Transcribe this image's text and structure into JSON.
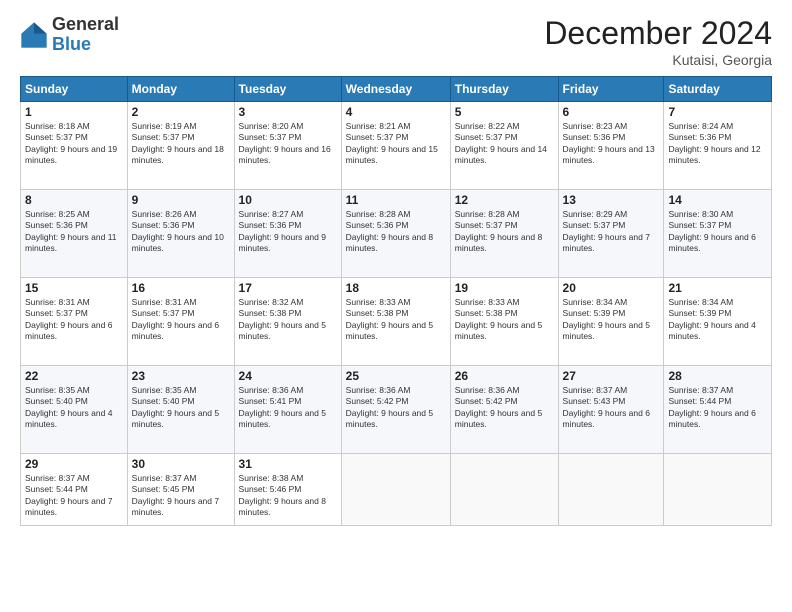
{
  "logo": {
    "general": "General",
    "blue": "Blue"
  },
  "title": "December 2024",
  "location": "Kutaisi, Georgia",
  "days_header": [
    "Sunday",
    "Monday",
    "Tuesday",
    "Wednesday",
    "Thursday",
    "Friday",
    "Saturday"
  ],
  "weeks": [
    [
      {
        "day": "1",
        "sunrise": "8:18 AM",
        "sunset": "5:37 PM",
        "daylight_hours": "9",
        "daylight_minutes": "19"
      },
      {
        "day": "2",
        "sunrise": "8:19 AM",
        "sunset": "5:37 PM",
        "daylight_hours": "9",
        "daylight_minutes": "18"
      },
      {
        "day": "3",
        "sunrise": "8:20 AM",
        "sunset": "5:37 PM",
        "daylight_hours": "9",
        "daylight_minutes": "16"
      },
      {
        "day": "4",
        "sunrise": "8:21 AM",
        "sunset": "5:37 PM",
        "daylight_hours": "9",
        "daylight_minutes": "15"
      },
      {
        "day": "5",
        "sunrise": "8:22 AM",
        "sunset": "5:37 PM",
        "daylight_hours": "9",
        "daylight_minutes": "14"
      },
      {
        "day": "6",
        "sunrise": "8:23 AM",
        "sunset": "5:36 PM",
        "daylight_hours": "9",
        "daylight_minutes": "13"
      },
      {
        "day": "7",
        "sunrise": "8:24 AM",
        "sunset": "5:36 PM",
        "daylight_hours": "9",
        "daylight_minutes": "12"
      }
    ],
    [
      {
        "day": "8",
        "sunrise": "8:25 AM",
        "sunset": "5:36 PM",
        "daylight_hours": "9",
        "daylight_minutes": "11"
      },
      {
        "day": "9",
        "sunrise": "8:26 AM",
        "sunset": "5:36 PM",
        "daylight_hours": "9",
        "daylight_minutes": "10"
      },
      {
        "day": "10",
        "sunrise": "8:27 AM",
        "sunset": "5:36 PM",
        "daylight_hours": "9",
        "daylight_minutes": "9"
      },
      {
        "day": "11",
        "sunrise": "8:28 AM",
        "sunset": "5:36 PM",
        "daylight_hours": "9",
        "daylight_minutes": "8"
      },
      {
        "day": "12",
        "sunrise": "8:28 AM",
        "sunset": "5:37 PM",
        "daylight_hours": "9",
        "daylight_minutes": "8"
      },
      {
        "day": "13",
        "sunrise": "8:29 AM",
        "sunset": "5:37 PM",
        "daylight_hours": "9",
        "daylight_minutes": "7"
      },
      {
        "day": "14",
        "sunrise": "8:30 AM",
        "sunset": "5:37 PM",
        "daylight_hours": "9",
        "daylight_minutes": "6"
      }
    ],
    [
      {
        "day": "15",
        "sunrise": "8:31 AM",
        "sunset": "5:37 PM",
        "daylight_hours": "9",
        "daylight_minutes": "6"
      },
      {
        "day": "16",
        "sunrise": "8:31 AM",
        "sunset": "5:37 PM",
        "daylight_hours": "9",
        "daylight_minutes": "6"
      },
      {
        "day": "17",
        "sunrise": "8:32 AM",
        "sunset": "5:38 PM",
        "daylight_hours": "9",
        "daylight_minutes": "5"
      },
      {
        "day": "18",
        "sunrise": "8:33 AM",
        "sunset": "5:38 PM",
        "daylight_hours": "9",
        "daylight_minutes": "5"
      },
      {
        "day": "19",
        "sunrise": "8:33 AM",
        "sunset": "5:38 PM",
        "daylight_hours": "9",
        "daylight_minutes": "5"
      },
      {
        "day": "20",
        "sunrise": "8:34 AM",
        "sunset": "5:39 PM",
        "daylight_hours": "9",
        "daylight_minutes": "5"
      },
      {
        "day": "21",
        "sunrise": "8:34 AM",
        "sunset": "5:39 PM",
        "daylight_hours": "9",
        "daylight_minutes": "4"
      }
    ],
    [
      {
        "day": "22",
        "sunrise": "8:35 AM",
        "sunset": "5:40 PM",
        "daylight_hours": "9",
        "daylight_minutes": "4"
      },
      {
        "day": "23",
        "sunrise": "8:35 AM",
        "sunset": "5:40 PM",
        "daylight_hours": "9",
        "daylight_minutes": "5"
      },
      {
        "day": "24",
        "sunrise": "8:36 AM",
        "sunset": "5:41 PM",
        "daylight_hours": "9",
        "daylight_minutes": "5"
      },
      {
        "day": "25",
        "sunrise": "8:36 AM",
        "sunset": "5:42 PM",
        "daylight_hours": "9",
        "daylight_minutes": "5"
      },
      {
        "day": "26",
        "sunrise": "8:36 AM",
        "sunset": "5:42 PM",
        "daylight_hours": "9",
        "daylight_minutes": "5"
      },
      {
        "day": "27",
        "sunrise": "8:37 AM",
        "sunset": "5:43 PM",
        "daylight_hours": "9",
        "daylight_minutes": "6"
      },
      {
        "day": "28",
        "sunrise": "8:37 AM",
        "sunset": "5:44 PM",
        "daylight_hours": "9",
        "daylight_minutes": "6"
      }
    ],
    [
      {
        "day": "29",
        "sunrise": "8:37 AM",
        "sunset": "5:44 PM",
        "daylight_hours": "9",
        "daylight_minutes": "7"
      },
      {
        "day": "30",
        "sunrise": "8:37 AM",
        "sunset": "5:45 PM",
        "daylight_hours": "9",
        "daylight_minutes": "7"
      },
      {
        "day": "31",
        "sunrise": "8:38 AM",
        "sunset": "5:46 PM",
        "daylight_hours": "9",
        "daylight_minutes": "8"
      },
      null,
      null,
      null,
      null
    ]
  ]
}
